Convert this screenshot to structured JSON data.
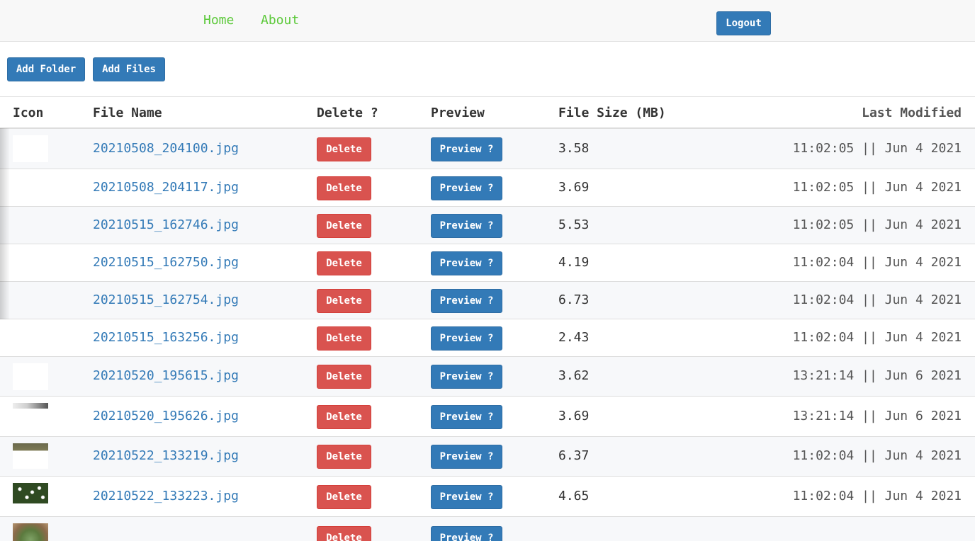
{
  "nav": {
    "home": "Home",
    "about": "About",
    "logout": "Logout"
  },
  "toolbar": {
    "add_folder": "Add Folder",
    "add_files": "Add Files"
  },
  "table": {
    "headers": {
      "icon": "Icon",
      "name": "File Name",
      "delete": "Delete ?",
      "preview": "Preview",
      "size": "File Size (MB)",
      "modified": "Last Modified"
    },
    "delete_label": "Delete",
    "preview_label": "Preview ?",
    "rows": [
      {
        "thumb": "white",
        "name": "20210508_204100.jpg",
        "size": "3.58",
        "modified": "11:02:05 || Jun 4 2021"
      },
      {
        "thumb": "none",
        "name": "20210508_204117.jpg",
        "size": "3.69",
        "modified": "11:02:05 || Jun 4 2021"
      },
      {
        "thumb": "none",
        "name": "20210515_162746.jpg",
        "size": "5.53",
        "modified": "11:02:05 || Jun 4 2021"
      },
      {
        "thumb": "none",
        "name": "20210515_162750.jpg",
        "size": "4.19",
        "modified": "11:02:04 || Jun 4 2021"
      },
      {
        "thumb": "none",
        "name": "20210515_162754.jpg",
        "size": "6.73",
        "modified": "11:02:04 || Jun 4 2021"
      },
      {
        "thumb": "none",
        "name": "20210515_163256.jpg",
        "size": "2.43",
        "modified": "11:02:04 || Jun 4 2021"
      },
      {
        "thumb": "white",
        "name": "20210520_195615.jpg",
        "size": "3.62",
        "modified": "13:21:14 || Jun 6 2021"
      },
      {
        "thumb": "gray",
        "name": "20210520_195626.jpg",
        "size": "3.69",
        "modified": "13:21:14 || Jun 6 2021"
      },
      {
        "thumb": "wood",
        "name": "20210522_133219.jpg",
        "size": "6.37",
        "modified": "11:02:04 || Jun 4 2021"
      },
      {
        "thumb": "flowers",
        "name": "20210522_133223.jpg",
        "size": "4.65",
        "modified": "11:02:04 || Jun 4 2021"
      },
      {
        "thumb": "plant",
        "name": "",
        "size": "",
        "modified": ""
      }
    ]
  }
}
